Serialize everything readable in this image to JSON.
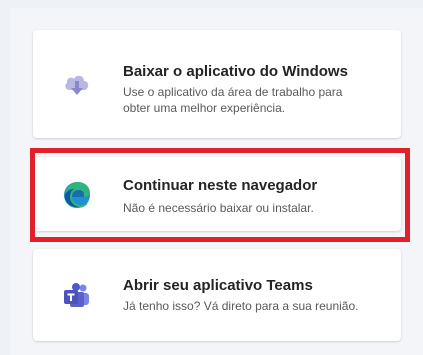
{
  "options": {
    "windows": {
      "icon": "cloud-download-icon",
      "title": "Baixar o aplicativo do Windows",
      "description": "Use o aplicativo da área de trabalho para obter uma melhor experiência."
    },
    "browser": {
      "icon": "edge-browser-icon",
      "title": "Continuar neste navegador",
      "description": "Não é necessário baixar ou instalar."
    },
    "teams": {
      "icon": "teams-icon",
      "title": "Abrir seu aplicativo Teams",
      "description": "Já tenho isso? Vá direto para a sua reunião."
    }
  },
  "colors": {
    "highlight": "#e0202a",
    "cloud_icon": "#a9a7db",
    "teams_icon": "#5b5fc7"
  }
}
